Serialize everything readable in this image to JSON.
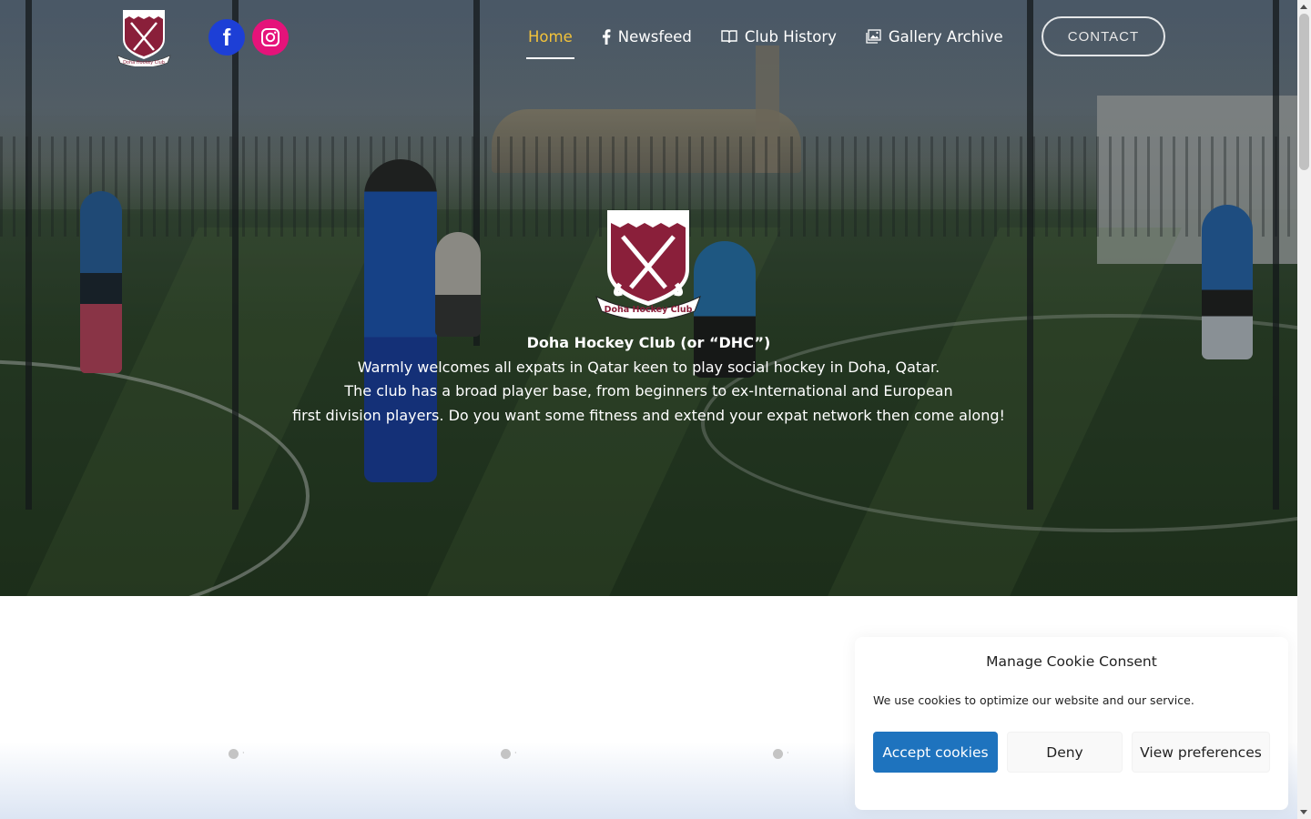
{
  "nav": {
    "items": [
      {
        "label": "Home",
        "icon": "",
        "active": true
      },
      {
        "label": "Newsfeed",
        "icon": "facebook-icon",
        "active": false
      },
      {
        "label": "Club History",
        "icon": "book-icon",
        "active": false
      },
      {
        "label": "Gallery Archive",
        "icon": "gallery-icon",
        "active": false
      }
    ],
    "contact_label": "CONTACT",
    "active_color": "#f3c33a"
  },
  "social": {
    "facebook": {
      "icon": "facebook-icon",
      "color": "#1d3fd6"
    },
    "instagram": {
      "icon": "instagram-icon",
      "color": "#e5137a"
    }
  },
  "logo": {
    "text": "Doha Hockey Club",
    "crest_color": "#8a1f3a"
  },
  "hero": {
    "title": "Doha Hockey Club (or “DHC”)",
    "lines": [
      "Warmly welcomes all expats in Qatar keen to play social hockey in Doha, Qatar.",
      "The club has a broad player base, from beginners to ex-International and European",
      "first division players. Do you want some fitness and extend your expat network then come along!"
    ]
  },
  "slider": {
    "dots": [
      "·",
      "·",
      "·"
    ]
  },
  "cookie": {
    "title": "Manage Cookie Consent",
    "text": "We use cookies to optimize our website and our service.",
    "accept_label": "Accept cookies",
    "deny_label": "Deny",
    "preferences_label": "View preferences",
    "accept_color": "#1e73be"
  }
}
